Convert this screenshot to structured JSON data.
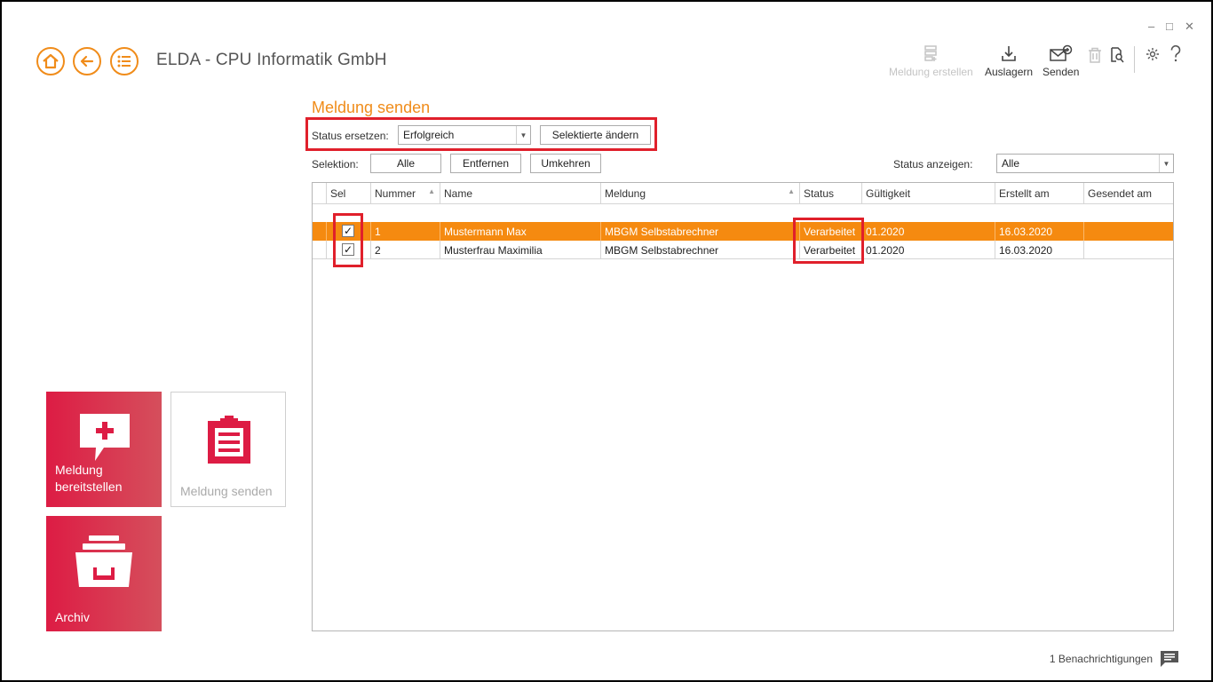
{
  "window": {
    "minimize": "–",
    "maximize": "□",
    "close": "✕"
  },
  "nav": {
    "home_icon": "home-icon",
    "back_icon": "back-arrow-icon",
    "list_icon": "list-icon"
  },
  "app_title": "ELDA - CPU Informatik GmbH",
  "toolbar": {
    "meldung_erstellen": "Meldung erstellen",
    "auslagern": "Auslagern",
    "senden": "Senden"
  },
  "tiles": {
    "bereitstellen": "Meldung bereitstellen",
    "senden": "Meldung senden",
    "archiv": "Archiv"
  },
  "page_heading": "Meldung senden",
  "status_replace": {
    "label": "Status ersetzen:",
    "value": "Erfolgreich",
    "button": "Selektierte ändern"
  },
  "selection": {
    "label": "Selektion:",
    "all": "Alle",
    "remove": "Entfernen",
    "invert": "Umkehren"
  },
  "status_show": {
    "label": "Status anzeigen:",
    "value": "Alle"
  },
  "grid": {
    "columns": [
      "Sel",
      "Nummer",
      "Name",
      "Meldung",
      "Status",
      "Gültigkeit",
      "Erstellt am",
      "Gesendet am"
    ],
    "rows": [
      {
        "checked": "✓",
        "number": "1",
        "name": "Mustermann Max",
        "meldung": "MBGM Selbstabrechner",
        "status": "Verarbeitet",
        "validity": "01.2020",
        "created": "16.03.2020",
        "sent": ""
      },
      {
        "checked": "✓",
        "number": "2",
        "name": "Musterfrau Maximilia",
        "meldung": "MBGM Selbstabrechner",
        "status": "Verarbeitet",
        "validity": "01.2020",
        "created": "16.03.2020",
        "sent": ""
      }
    ]
  },
  "footer": {
    "notifications": "1 Benachrichtigungen"
  },
  "colors": {
    "accent": "#f08c1a",
    "tile_red": "#dd1c44",
    "highlight_box": "#e0202b",
    "selected_row": "#f58a10"
  }
}
